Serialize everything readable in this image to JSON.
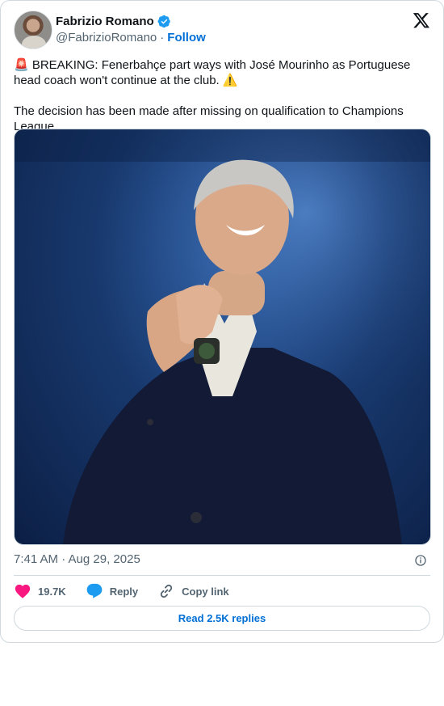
{
  "author": {
    "name": "Fabrizio Romano",
    "handle": "@FabrizioRomano",
    "separator": "·",
    "follow_label": "Follow",
    "verified": true
  },
  "tweet": {
    "text": "🚨 BREAKING: Fenerbahçe part ways with José Mourinho as Portuguese head coach won't continue at the club. ⚠️\n\nThe decision has been made after missing on qualification to Champions League."
  },
  "meta": {
    "timestamp": "7:41 AM · Aug 29, 2025"
  },
  "actions": {
    "like_count": "19.7K",
    "reply_label": "Reply",
    "copy_label": "Copy link"
  },
  "read_replies_label": "Read 2.5K replies",
  "colors": {
    "accent": "#006fd6",
    "like": "#f91880",
    "reply": "#1d9bf0",
    "muted": "#536471",
    "border": "#cfd9de"
  },
  "icons": [
    "x-logo-icon",
    "verified-badge-icon",
    "info-icon",
    "heart-icon",
    "reply-bubble-icon",
    "link-icon"
  ]
}
